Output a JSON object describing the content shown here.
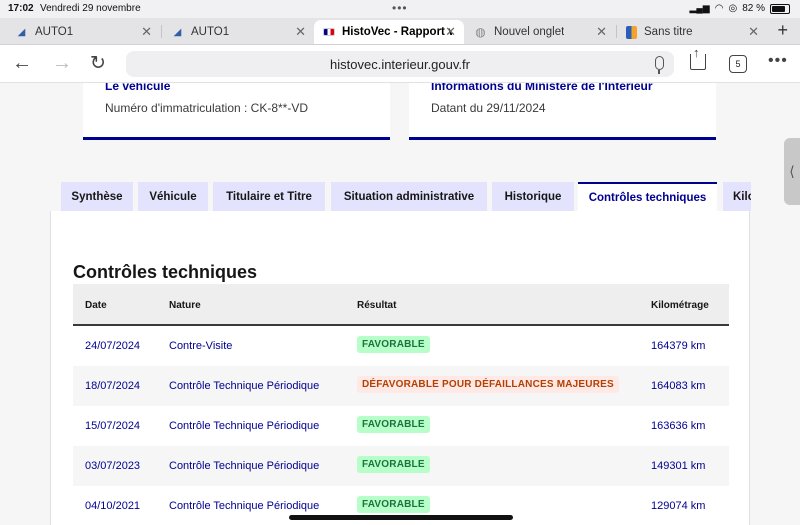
{
  "status_bar": {
    "time": "17:02",
    "date": "Vendredi 29 novembre",
    "battery": "82 %",
    "battery_level": 0.82
  },
  "browser_tabs": [
    {
      "title": "AUTO1",
      "icon": "auto1-favicon",
      "active": false
    },
    {
      "title": "AUTO1",
      "icon": "auto1-favicon",
      "active": false
    },
    {
      "title": "HistoVec - Rapport ve",
      "icon": "french-flag-favicon",
      "active": true
    },
    {
      "title": "Nouvel onglet",
      "icon": "globe-icon",
      "active": false
    },
    {
      "title": "Sans titre",
      "icon": "doc-favicon",
      "active": false
    }
  ],
  "address_bar": {
    "url": "histovec.interieur.gouv.fr",
    "tab_count": "5"
  },
  "info_cards": {
    "vehicle": {
      "heading": "Le véhicule",
      "value": "Numéro d'immatriculation : CK-8**-VD"
    },
    "ministry": {
      "heading": "Informations du Ministère de l'Intérieur",
      "value": "Datant du 29/11/2024"
    }
  },
  "nav_tabs": [
    {
      "label": "Synthèse",
      "active": false
    },
    {
      "label": "Véhicule",
      "active": false
    },
    {
      "label": "Titulaire et Titre",
      "active": false
    },
    {
      "label": "Situation administrative",
      "active": false
    },
    {
      "label": "Historique",
      "active": false
    },
    {
      "label": "Contrôles techniques",
      "active": true
    },
    {
      "label": "Kilo",
      "active": false
    }
  ],
  "section": {
    "title": "Contrôles techniques"
  },
  "table": {
    "headers": {
      "date": "Date",
      "nature": "Nature",
      "result": "Résultat",
      "mileage": "Kilométrage"
    },
    "rows": [
      {
        "date": "24/07/2024",
        "nature": "Contre-Visite",
        "result": "FAVORABLE",
        "status": "ok",
        "mileage": "164379 km"
      },
      {
        "date": "18/07/2024",
        "nature": "Contrôle Technique Périodique",
        "result": "DÉFAVORABLE POUR DÉFAILLANCES MAJEURES",
        "status": "ko",
        "mileage": "164083 km"
      },
      {
        "date": "15/07/2024",
        "nature": "Contrôle Technique Périodique",
        "result": "FAVORABLE",
        "status": "ok",
        "mileage": "163636 km"
      },
      {
        "date": "03/07/2023",
        "nature": "Contrôle Technique Périodique",
        "result": "FAVORABLE",
        "status": "ok",
        "mileage": "149301 km"
      },
      {
        "date": "04/10/2021",
        "nature": "Contrôle Technique Périodique",
        "result": "FAVORABLE",
        "status": "ok",
        "mileage": "129074 km"
      }
    ]
  },
  "colors": {
    "brand_blue": "#000091",
    "tab_bg": "#e3e3fd",
    "success_bg": "#b8fec9",
    "success_text": "#18753c",
    "error_bg": "#ffe9e6",
    "error_text": "#b34000"
  }
}
